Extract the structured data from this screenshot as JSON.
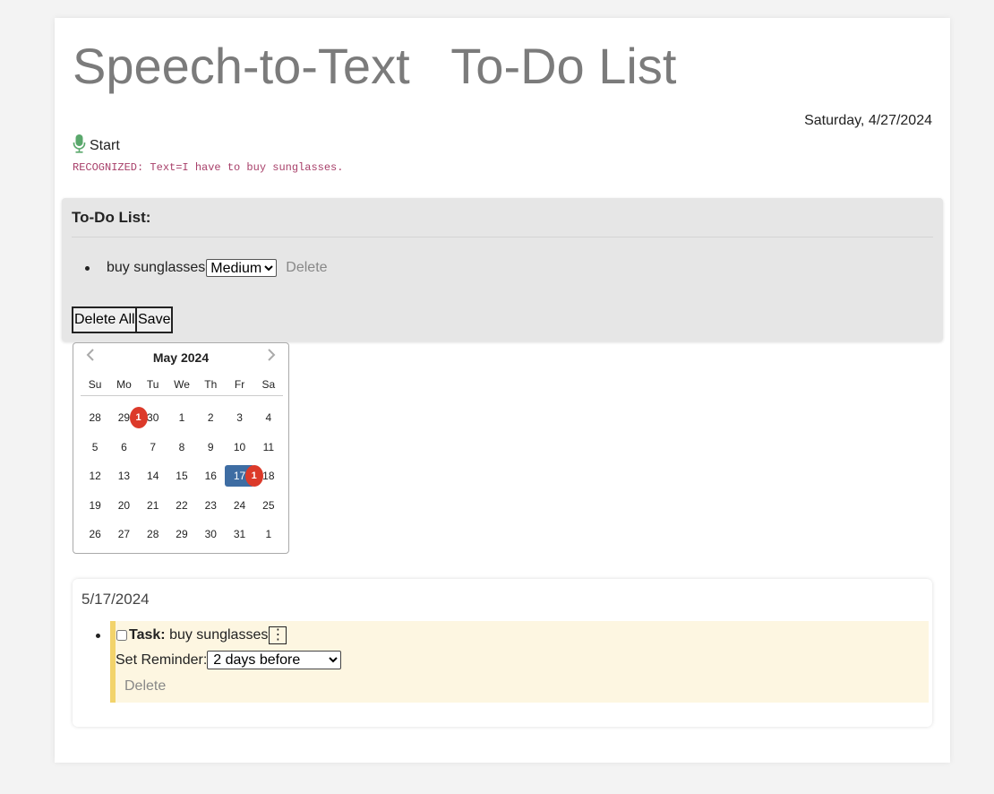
{
  "header": {
    "title": "Speech-to-Text   To-Do List",
    "date": "Saturday, 4/27/2024"
  },
  "speech": {
    "start_label": "Start",
    "recognized_text": "RECOGNIZED: Text=I have to buy sunglasses."
  },
  "todo": {
    "heading": "To-Do List:",
    "items": [
      {
        "text": "buy sunglasses",
        "priority": "Medium",
        "delete_label": "Delete"
      }
    ],
    "delete_all_label": "Delete All",
    "save_label": "Save"
  },
  "calendar": {
    "month_label": "May 2024",
    "prev_icon": "chevron-left-icon",
    "next_icon": "chevron-right-icon",
    "weekdays": [
      "Su",
      "Mo",
      "Tu",
      "We",
      "Th",
      "Fr",
      "Sa"
    ],
    "weeks": [
      [
        "28",
        "29",
        "30",
        "1",
        "2",
        "3",
        "4"
      ],
      [
        "5",
        "6",
        "7",
        "8",
        "9",
        "10",
        "11"
      ],
      [
        "12",
        "13",
        "14",
        "15",
        "16",
        "17",
        "18"
      ],
      [
        "19",
        "20",
        "21",
        "22",
        "23",
        "24",
        "25"
      ],
      [
        "26",
        "27",
        "28",
        "29",
        "30",
        "31",
        "1"
      ]
    ],
    "selected_day": "17",
    "badges": [
      {
        "week": 0,
        "after_day_index": 1,
        "count": "1"
      },
      {
        "week": 2,
        "after_day_index": 5,
        "count": "1"
      }
    ],
    "badge_color": "#dc3a2a",
    "selected_color": "#3e6da3"
  },
  "day_view": {
    "date": "5/17/2024",
    "task_label": "Task:",
    "task_text": "buy sunglasses",
    "menu_glyph": "⋮",
    "reminder_label": "Set Reminder:",
    "reminder_value": "2 days before",
    "delete_label": "Delete"
  }
}
